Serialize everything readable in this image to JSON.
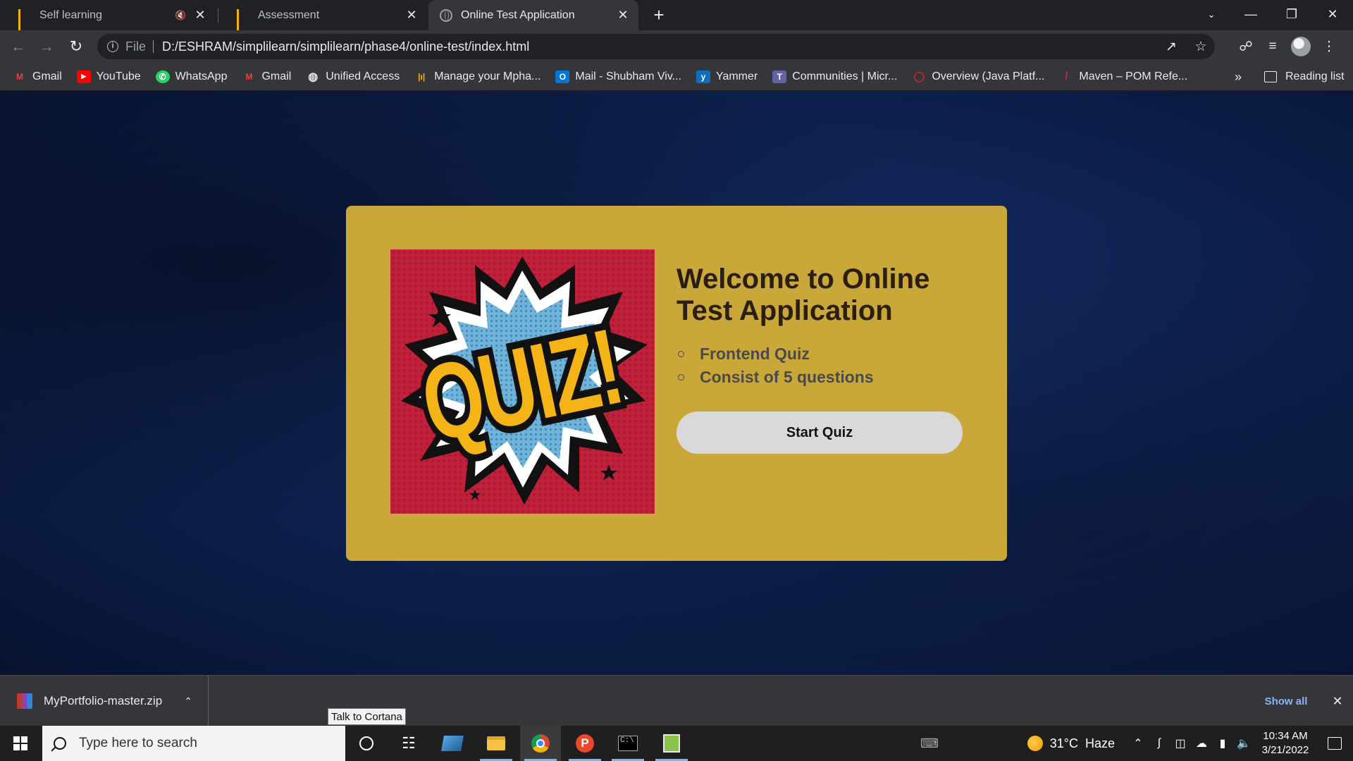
{
  "browser": {
    "tabs": [
      {
        "title": "Self learning",
        "icon": "bars-favicon",
        "audio": "🔇",
        "active": false
      },
      {
        "title": "Assessment",
        "icon": "bars-favicon",
        "active": false
      },
      {
        "title": "Online Test Application",
        "icon": "globe-favicon",
        "active": true
      }
    ],
    "new_tab_label": "+",
    "address": {
      "scheme_label": "File",
      "url": "D:/ESHRAM/simplilearn/simplilearn/phase4/online-test/index.html"
    },
    "bookmarks": [
      {
        "label": "Gmail",
        "icon": "gmail-icon",
        "glyph": "M",
        "color": "#ea4335"
      },
      {
        "label": "YouTube",
        "icon": "youtube-icon",
        "glyph": "▶",
        "color": "#ff0000"
      },
      {
        "label": "WhatsApp",
        "icon": "whatsapp-icon",
        "glyph": "✆",
        "color": "#25d366"
      },
      {
        "label": "Gmail",
        "icon": "gmail-icon",
        "glyph": "M",
        "color": "#ea4335"
      },
      {
        "label": "Unified Access",
        "icon": "globe-icon",
        "glyph": "◍",
        "color": "#9aa0a6"
      },
      {
        "label": "Manage your Mpha...",
        "icon": "bars-icon",
        "glyph": "|ı|",
        "color": "#f4b400"
      },
      {
        "label": "Mail - Shubham Viv...",
        "icon": "outlook-icon",
        "glyph": "O",
        "color": "#0078d4"
      },
      {
        "label": "Yammer",
        "icon": "yammer-icon",
        "glyph": "y",
        "color": "#106ebe"
      },
      {
        "label": "Communities | Micr...",
        "icon": "teams-icon",
        "glyph": "T",
        "color": "#6264a7"
      },
      {
        "label": "Overview (Java Platf...",
        "icon": "oracle-icon",
        "glyph": "◯",
        "color": "#e01f26"
      },
      {
        "label": "Maven – POM Refe...",
        "icon": "maven-icon",
        "glyph": "/",
        "color": "#c7254e"
      }
    ],
    "bookmarks_overflow": "»",
    "reading_list_label": "Reading list"
  },
  "page": {
    "title": "Welcome to Online Test Application",
    "items": [
      "Frontend Quiz",
      "Consist of 5 questions"
    ],
    "start_button": "Start Quiz",
    "card_color": "#c9a738",
    "art_text": "QUIZ!"
  },
  "downloads": {
    "file_name": "MyPortfolio-master.zip",
    "show_all_label": "Show all"
  },
  "tooltip": "Talk to Cortana",
  "taskbar": {
    "search_placeholder": "Type here to search",
    "weather": "31°C  Haze",
    "time": "10:34 AM",
    "date": "3/21/2022"
  }
}
